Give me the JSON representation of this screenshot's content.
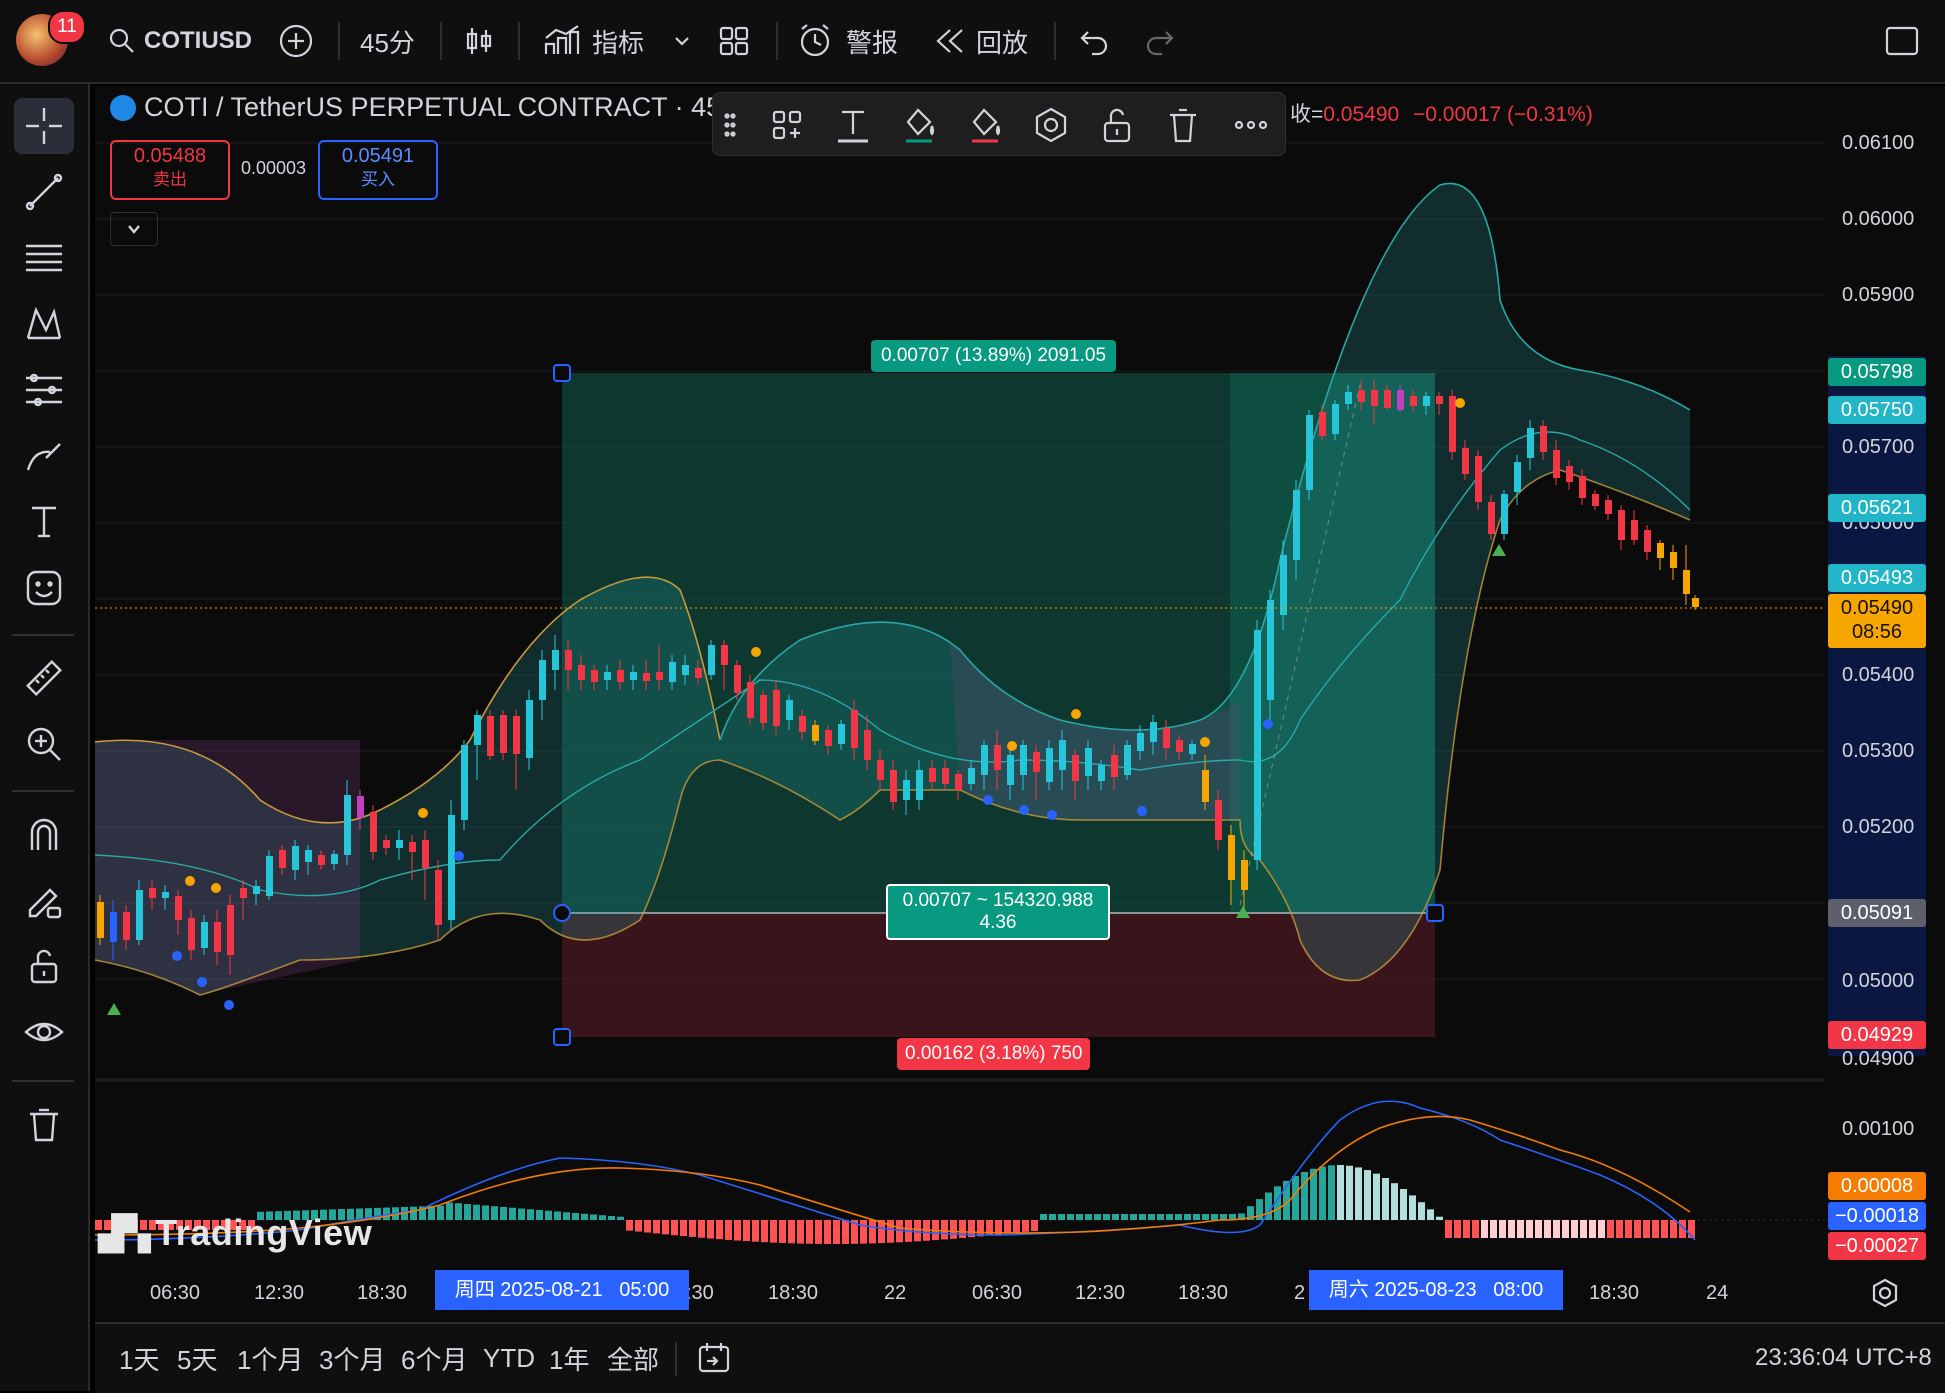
{
  "topbar": {
    "notifications": "11",
    "symbol": "COTIUSD",
    "interval": "45分",
    "indicators": "指标",
    "alert": "警报",
    "replay": "回放"
  },
  "legend": {
    "title": "COTI / TetherUS PERPETUAL CONTRACT · 45 ·",
    "close_prefix": "收=",
    "close": "0.05490",
    "change": "−0.00017 (−0.31%)"
  },
  "trade": {
    "sell_price": "0.05488",
    "sell_label": "卖出",
    "spread": "0.00003",
    "buy_price": "0.05491",
    "buy_label": "买入"
  },
  "position": {
    "target_label": "0.00707 (13.89%) 2091.05",
    "center_line1": "0.00707 ~ 154320.988",
    "center_line2": "4.36",
    "stop_label": "0.00162 (3.18%) 750"
  },
  "price_axis": {
    "ticks": [
      "0.06100",
      "0.06000",
      "0.05900",
      "0.05700",
      "0.05600",
      "0.05400",
      "0.05300",
      "0.05200",
      "0.05000",
      "0.04900"
    ],
    "labels": [
      {
        "text": "0.05798",
        "bg": "#089981"
      },
      {
        "text": "0.05750",
        "bg": "#22b5c8"
      },
      {
        "text": "0.05621",
        "bg": "#22b5c8"
      },
      {
        "text": "0.05493",
        "bg": "#22b5c8"
      },
      {
        "text": "0.05490",
        "sub": "08:56",
        "bg": "#f7a600"
      },
      {
        "text": "0.05091",
        "bg": "#5d606b"
      },
      {
        "text": "0.04929",
        "bg": "#f23645"
      }
    ]
  },
  "macd_axis": {
    "tick": "0.00100",
    "labels": [
      {
        "text": "0.00008",
        "bg": "#f57c00"
      },
      {
        "text": "−0.00018",
        "bg": "#2962ff"
      },
      {
        "text": "−0.00027",
        "bg": "#f23645"
      }
    ]
  },
  "time_axis": {
    "ticks": [
      "06:30",
      "12:30",
      "18:30",
      ":30",
      "18:30",
      "22",
      "06:30",
      "12:30",
      "18:30",
      "2",
      "18:30",
      "24"
    ],
    "crosshair_start": "周四 2025-08-21   05:00",
    "crosshair_end": "周六 2025-08-23   08:00"
  },
  "watermark": "TradingView",
  "bottombar": {
    "ranges": [
      "1天",
      "5天",
      "1个月",
      "3个月",
      "6个月",
      "YTD",
      "1年",
      "全部"
    ],
    "clock": "23:36:04 UTC+8"
  },
  "colors": {
    "up": "#26c6da",
    "down": "#f23645",
    "accent": "#2962ff",
    "profit": "#089981",
    "loss": "#f23645"
  }
}
